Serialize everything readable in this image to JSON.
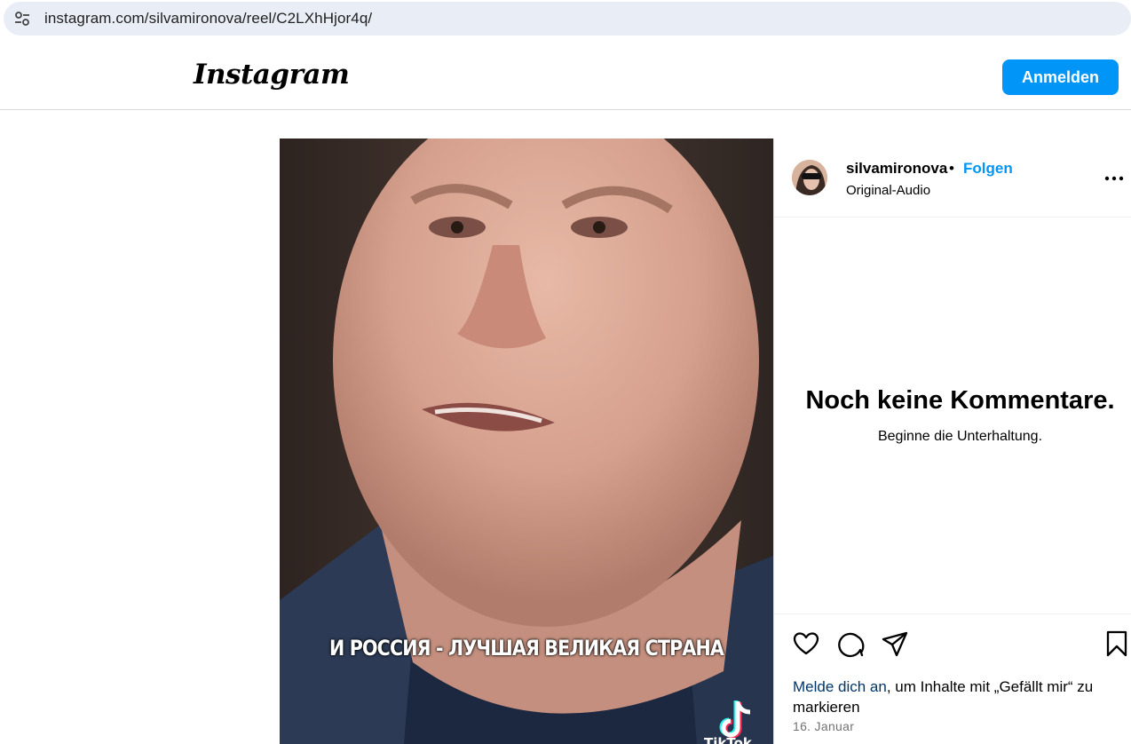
{
  "browser": {
    "url": "instagram.com/silvamironova/reel/C2LXhHjor4q/",
    "site_info_icon": "tune-icon"
  },
  "header": {
    "logo_text": "Instagram",
    "login_button": "Anmelden",
    "accent_color": "#0095f6"
  },
  "video": {
    "subtitle": "И РОССИЯ - ЛУЧШАЯ ВЕЛИКАЯ СТРАНА",
    "watermark": "TikTok",
    "watermark_icon": "tiktok-logo-icon"
  },
  "post": {
    "username": "silvamironova",
    "separator": "•",
    "follow_label": "Folgen",
    "audio": "Original-Audio",
    "more_icon": "more-horizontal-icon"
  },
  "comments": {
    "empty_title": "Noch keine Kommentare.",
    "empty_subtitle": "Beginne die Unterhaltung."
  },
  "actions": {
    "icons": [
      "heart-icon",
      "comment-icon",
      "share-icon",
      "bookmark-icon"
    ],
    "login_link": "Melde dich an",
    "login_hint_rest": ", um Inhalte mit „Gefällt mir“ zu markieren",
    "date": "16. Januar"
  }
}
